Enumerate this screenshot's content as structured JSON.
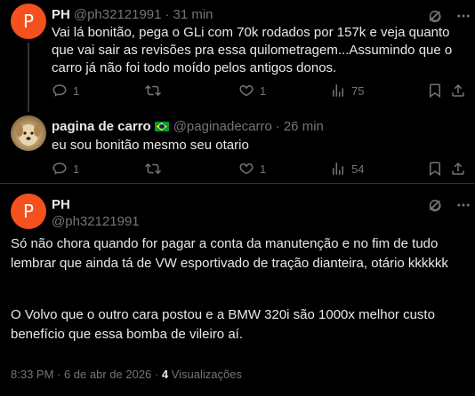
{
  "reply1": {
    "avatar_letter": "P",
    "name": "PH",
    "handle": "@ph32121991",
    "separator": "·",
    "time": "31 min",
    "text": "Vai lá bonitão, pega o GLi com 70k rodados por 157k e veja quanto que vai sair as revisões pra essa quilometragem...Assumindo que o carro já não foi todo moído pelos antigos donos.",
    "replies": "1",
    "reposts": "",
    "likes": "1",
    "views": "75"
  },
  "reply2": {
    "name": "pagina de carro",
    "handle": "@paginadecarro",
    "separator": "·",
    "time": "26 min",
    "text": "eu sou bonitão mesmo seu otario",
    "replies": "1",
    "reposts": "",
    "likes": "1",
    "views": "54"
  },
  "main": {
    "avatar_letter": "P",
    "name": "PH",
    "handle": "@ph32121991",
    "paragraph1": "Só não chora quando for pagar a conta da manutenção e no fim de tudo lembrar que ainda tá de VW esportivado de tração dianteira, otário kkkkkk",
    "paragraph2": "O Volvo que o outro cara postou e a BMW 320i são 1000x melhor custo benefício que essa bomba de vileiro aí.",
    "timestamp": "8:33 PM · 6 de abr de 2026 ·",
    "views_count": "4",
    "views_label": "Visualizações"
  },
  "colors": {
    "accent_avatar": "#f4511e",
    "muted": "#71767b",
    "text": "#e7e9ea",
    "background": "#000000"
  }
}
